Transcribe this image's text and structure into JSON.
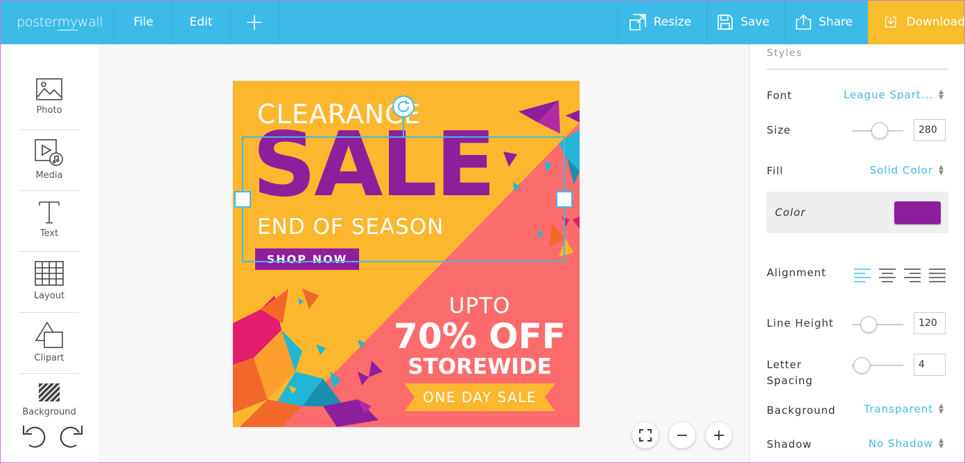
{
  "topbar": {
    "logo_a": "poster",
    "logo_b": "my",
    "logo_c": "wall",
    "file": "File",
    "edit": "Edit",
    "add": "+",
    "resize": "Resize",
    "save": "Save",
    "share": "Share",
    "download": "Download"
  },
  "sidebar": {
    "items": [
      {
        "label": "Photo"
      },
      {
        "label": "Media"
      },
      {
        "label": "Text"
      },
      {
        "label": "Layout"
      },
      {
        "label": "Clipart"
      },
      {
        "label": "Background"
      }
    ]
  },
  "poster": {
    "clearance": "CLEARANCE",
    "sale": "SALE",
    "end_of_season": "END OF SEASON",
    "shop_now": "SHOP NOW",
    "upto": "UPTO",
    "off": "70% OFF",
    "storewide": "STOREWIDE",
    "one_day_sale": "ONE DAY SALE",
    "colors": {
      "yellow": "#fcb72f",
      "coral": "#fd6c6c",
      "purple": "#8e1f9c"
    }
  },
  "zoom": {
    "fit": "⛶",
    "minus": "−",
    "plus": "+"
  },
  "panel": {
    "title": "Styles",
    "font_label": "Font",
    "font_value": "League Spart...",
    "size_label": "Size",
    "size_value": "280",
    "fill_label": "Fill",
    "fill_value": "Solid Color",
    "color_label": "Color",
    "color_value": "#8e1f9c",
    "alignment_label": "Alignment",
    "line_height_label": "Line Height",
    "line_height_value": "120",
    "letter_label_1": "Letter",
    "letter_label_2": "Spacing",
    "letter_value": "4",
    "background_label": "Background",
    "background_value": "Transparent",
    "shadow_label": "Shadow",
    "shadow_value": "No Shadow"
  }
}
